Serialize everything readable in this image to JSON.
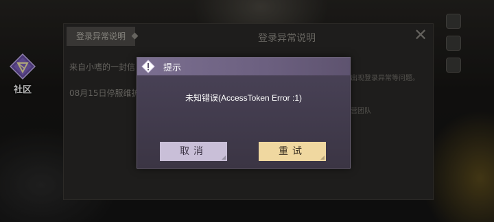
{
  "community": {
    "label": "社区",
    "icon": "community-gem-icon"
  },
  "notice_panel": {
    "tab_label": "登录异常说明",
    "title": "登录异常说明",
    "close_symbol": "✕",
    "items": [
      "来自小嗜的一封信",
      "08月15日停服维护"
    ],
    "content_line1": "出现登录异常等问题。",
    "content_line2": "营团队"
  },
  "dialog": {
    "title": "提示",
    "message": "未知错误(AccessToken Error :1)",
    "cancel_label": "取消",
    "retry_label": "重试",
    "header_icon": "alert-diamond-icon"
  },
  "colors": {
    "dialog_bg": "#3f3849",
    "header_bg": "#7b6f90",
    "cancel_bg": "#c9bfd8",
    "retry_bg": "#f0d8a0"
  }
}
